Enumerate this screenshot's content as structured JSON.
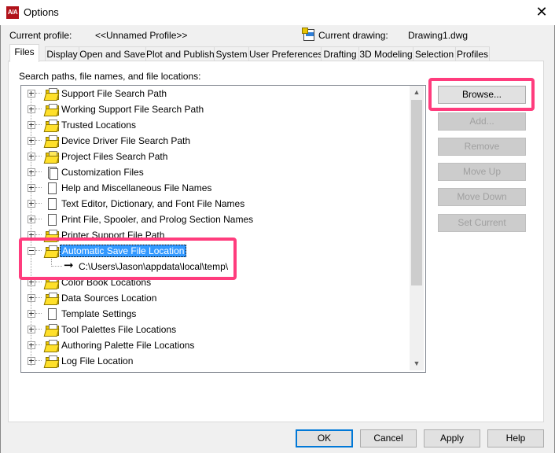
{
  "window": {
    "title": "Options",
    "app_icon_text": "A/A",
    "close_icon": "close-icon"
  },
  "profile": {
    "label": "Current profile:",
    "value": "<<Unnamed Profile>>"
  },
  "drawing": {
    "label": "Current drawing:",
    "value": "Drawing1.dwg"
  },
  "tabs": [
    "Files",
    "Display",
    "Open and Save",
    "Plot and Publish",
    "System",
    "User Preferences",
    "Drafting",
    "3D Modeling",
    "Selection",
    "Profiles"
  ],
  "active_tab": "Files",
  "search_label": "Search paths, file names, and file locations:",
  "tree": [
    {
      "label": "Support File Search Path",
      "icon": "folder-icon"
    },
    {
      "label": "Working Support File Search Path",
      "icon": "folder-icon"
    },
    {
      "label": "Trusted Locations",
      "icon": "folder-icon"
    },
    {
      "label": "Device Driver File Search Path",
      "icon": "folder-icon"
    },
    {
      "label": "Project Files Search Path",
      "icon": "folder-icon"
    },
    {
      "label": "Customization Files",
      "icon": "document-icon"
    },
    {
      "label": "Help and Miscellaneous File Names",
      "icon": "document-icon"
    },
    {
      "label": "Text Editor, Dictionary, and Font File Names",
      "icon": "document-icon"
    },
    {
      "label": "Print File, Spooler, and Prolog Section Names",
      "icon": "document-icon"
    },
    {
      "label": "Printer Support File Path",
      "icon": "folder-icon"
    },
    {
      "label": "Automatic Save File Location",
      "icon": "folder-icon",
      "selected": true,
      "expanded": true
    },
    {
      "label": "C:\\Users\\Jason\\appdata\\local\\temp\\",
      "icon": "arrow-icon",
      "child": true
    },
    {
      "label": "Color Book Locations",
      "icon": "folder-icon"
    },
    {
      "label": "Data Sources Location",
      "icon": "folder-icon"
    },
    {
      "label": "Template Settings",
      "icon": "document-icon"
    },
    {
      "label": "Tool Palettes File Locations",
      "icon": "folder-icon"
    },
    {
      "label": "Authoring Palette File Locations",
      "icon": "folder-icon"
    },
    {
      "label": "Log File Location",
      "icon": "folder-icon"
    }
  ],
  "side_buttons": {
    "browse": "Browse...",
    "add": "Add...",
    "remove": "Remove",
    "move_up": "Move Up",
    "move_down": "Move Down",
    "set_current": "Set Current"
  },
  "footer_buttons": {
    "ok": "OK",
    "cancel": "Cancel",
    "apply": "Apply",
    "help": "Help"
  },
  "colors": {
    "highlight": "#ff3c7d",
    "selection": "#3399ff",
    "default_button_border": "#0078d7"
  }
}
